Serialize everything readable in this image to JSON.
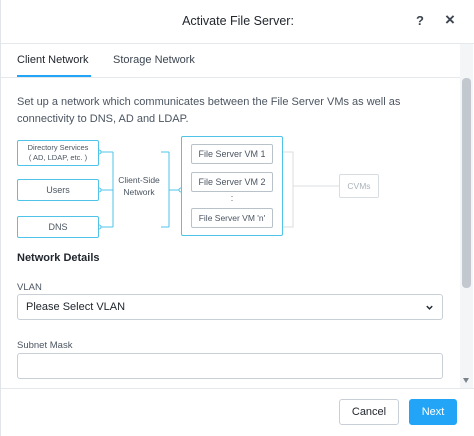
{
  "header": {
    "title": "Activate File Server:",
    "help": "?",
    "close": "×"
  },
  "tabs": [
    {
      "label": "Client Network",
      "active": true
    },
    {
      "label": "Storage Network",
      "active": false
    }
  ],
  "description": "Set up a network which communicates between the File Server VMs as well as connectivity to DNS, AD and LDAP.",
  "diagram": {
    "sources": [
      {
        "label": "Directory Services\n( AD, LDAP, etc. )"
      },
      {
        "label": "Users"
      },
      {
        "label": "DNS"
      }
    ],
    "network_label": "Client-Side\nNetwork",
    "vms": [
      "File Server VM 1",
      "File Server VM 2",
      "File Server VM 'n'"
    ],
    "vm_dots": ":",
    "cvms_label": "CVMs"
  },
  "network_details": {
    "title": "Network Details",
    "vlan": {
      "label": "VLAN",
      "value": "Please Select VLAN"
    },
    "subnet_mask": {
      "label": "Subnet Mask",
      "value": ""
    }
  },
  "footer": {
    "cancel": "Cancel",
    "next": "Next"
  },
  "colors": {
    "accent": "#22a5f7",
    "connector": "#4fc3e8"
  }
}
